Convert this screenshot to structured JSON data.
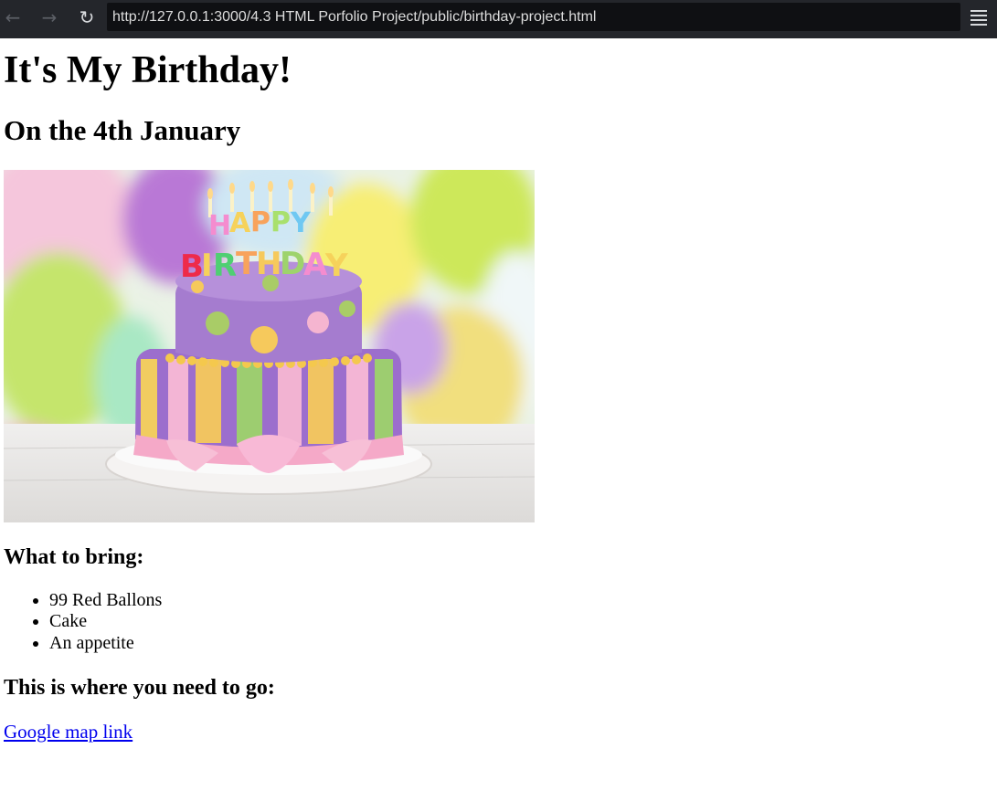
{
  "browser": {
    "url": "http://127.0.0.1:3000/4.3 HTML Porfolio Project/public/birthday-project.html",
    "back_icon": "arrow-left-icon",
    "forward_icon": "arrow-right-icon",
    "reload_icon": "reload-icon",
    "menu_icon": "hamburger-menu-icon",
    "colors": {
      "toolbar": "#24262b",
      "url_bar": "#0f1013",
      "url_text": "#dddddd"
    }
  },
  "page": {
    "heading": "It's My Birthday!",
    "subheading": "On the 4th January",
    "image": {
      "cake_candle_letters_top": "HAPPY",
      "cake_candle_letters_bottom": "BIRTHDAY"
    },
    "bring_heading": "What to bring:",
    "bring_items": [
      "99 Red Ballons",
      "Cake",
      "An appetite"
    ],
    "where_heading": "This is where you need to go:",
    "map_link_text": "Google map link",
    "link_color": "#0000ee"
  }
}
